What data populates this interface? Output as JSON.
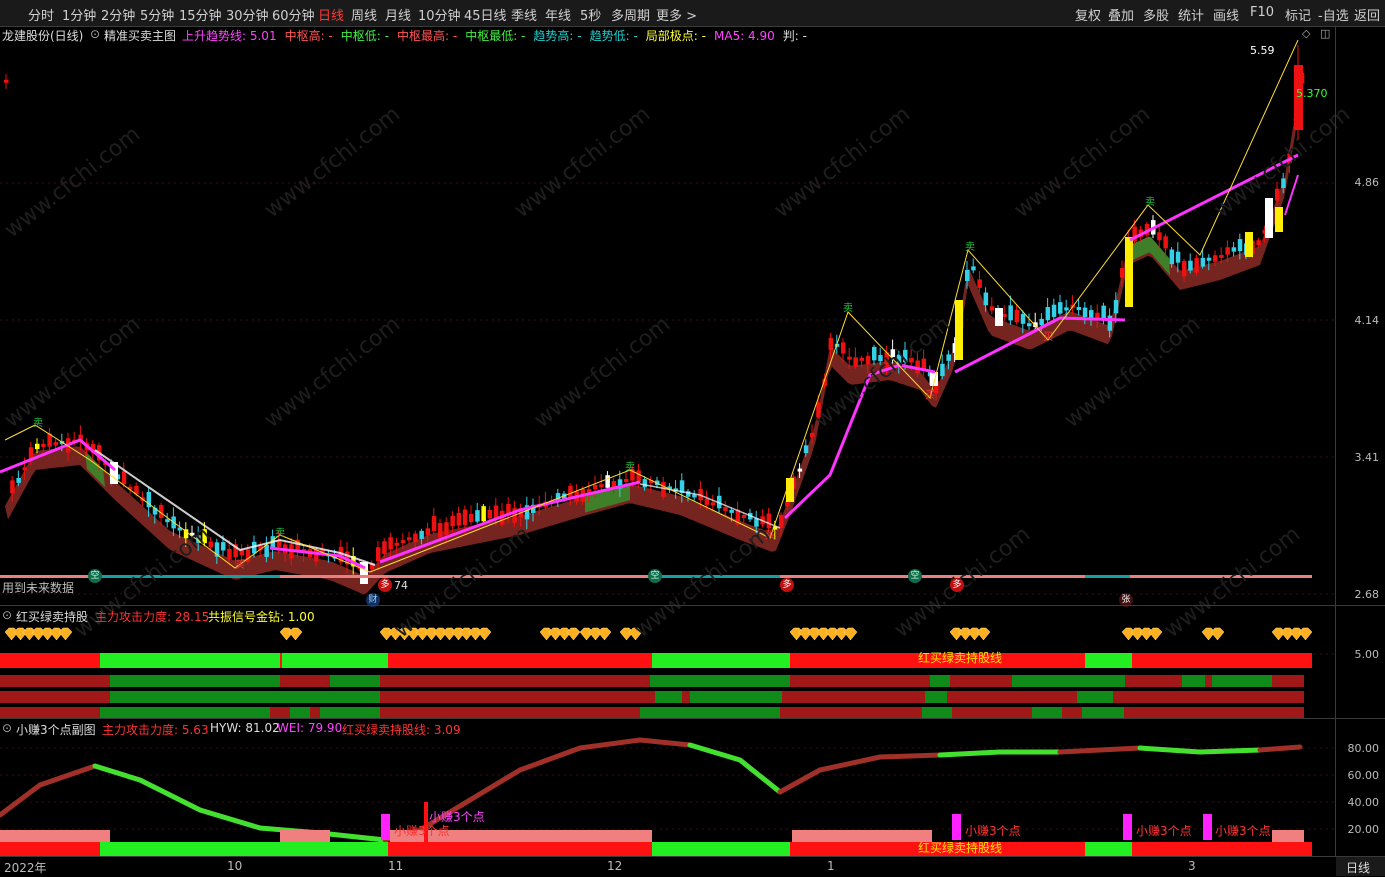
{
  "toolbar": {
    "periods": [
      "分时",
      "1分钟",
      "2分钟",
      "5分钟",
      "15分钟",
      "30分钟",
      "60分钟",
      "日线",
      "周线",
      "月线",
      "10分钟",
      "45日线",
      "季线",
      "年线",
      "5秒",
      "多周期",
      "更多 >"
    ],
    "active_period": "日线",
    "right_buttons": [
      "复权",
      "叠加",
      "多股",
      "统计",
      "画线",
      "F10",
      "标记",
      "-自选",
      "返回"
    ]
  },
  "main_panel": {
    "stock_name": "龙建股份(日线)",
    "indicator_name": "精准买卖主图",
    "legend": [
      {
        "label": "上升趋势线: 5.01",
        "color": "#ff44ff"
      },
      {
        "label": "中枢高: -",
        "color": "#ff5555"
      },
      {
        "label": "中枢低: -",
        "color": "#44ee44"
      },
      {
        "label": "中枢最高: -",
        "color": "#ff5555"
      },
      {
        "label": "中枢最低: -",
        "color": "#44ee44"
      },
      {
        "label": "趋势高: -",
        "color": "#22cccc"
      },
      {
        "label": "趋势低: -",
        "color": "#22cccc"
      },
      {
        "label": "局部极点: -",
        "color": "#ffff33"
      },
      {
        "label": "MA5: 4.90",
        "color": "#ff44ff"
      },
      {
        "label": "判: -",
        "color": "#dddddd"
      }
    ],
    "price_high_label": "5.59",
    "price_marker_label": "5.370",
    "y_axis": [
      "4.86",
      "4.14",
      "3.41",
      "2.68"
    ],
    "note_left": "用到未来数据",
    "marker_labels": {
      "sell": "卖",
      "buy": "买",
      "empty": "空",
      "more": "多",
      "cai": "财",
      "zhang": "张",
      "n74": "74"
    }
  },
  "panel2": {
    "title": "红买绿卖持股",
    "legend": [
      {
        "label": "主力攻击力度: 28.15",
        "color": "#ff3333"
      },
      {
        "label": "共振信号金钻: 1.00",
        "color": "#ffff33"
      }
    ],
    "y_axis": [
      "5.00"
    ],
    "bar_label": "红买绿卖持股线"
  },
  "panel3": {
    "title": "小赚3个点副图",
    "legend": [
      {
        "label": "主力攻击力度: 5.63",
        "color": "#ff3333"
      },
      {
        "label": "HYW: 81.02",
        "color": "#dddddd"
      },
      {
        "label": "WEI: 79.90",
        "color": "#ff44ff"
      },
      {
        "label": "红买绿卖持股线: 3.09",
        "color": "#ff3333"
      }
    ],
    "y_axis": [
      "80.00",
      "60.00",
      "40.00",
      "20.00"
    ],
    "signal_label": "小赚3个点",
    "bar_label": "红买绿卖持股线"
  },
  "date_axis": [
    "2022年",
    "10",
    "11",
    "12",
    "1",
    "3"
  ],
  "bottom_right_period": "日线",
  "watermark": "www.cfchi.com"
}
